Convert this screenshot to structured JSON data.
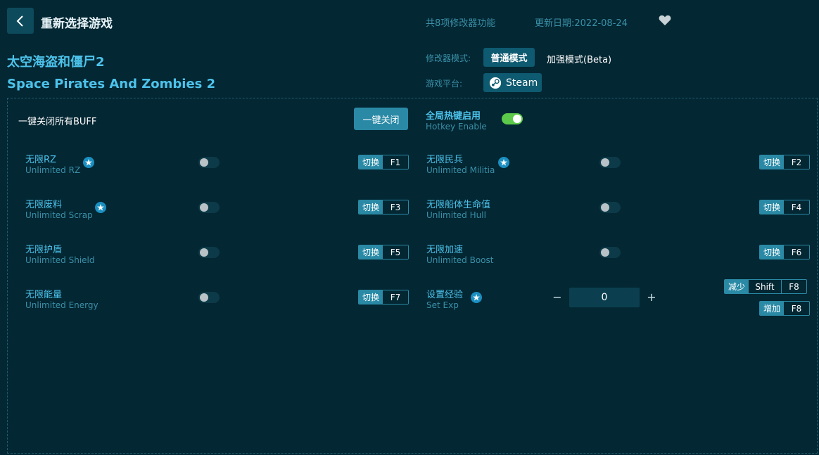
{
  "header": {
    "reselect_label": "重新选择游戏",
    "feature_count": "共8项修改器功能",
    "update_date": "更新日期:2022-08-24",
    "back_icon": "chevron-left-icon",
    "favorite_icon": "heart-icon"
  },
  "game": {
    "title_cn": "太空海盗和僵尸2",
    "title_en": "Space Pirates And Zombies 2"
  },
  "mode": {
    "label": "修改器模式:",
    "normal": "普通模式",
    "enhanced": "加强模式(Beta)",
    "selected": "普通模式"
  },
  "platform": {
    "label": "游戏平台:",
    "name": "Steam"
  },
  "controls": {
    "all_off_label": "一键关闭所有BUFF",
    "all_off_button": "一键关闭",
    "hotkey_cn": "全局热键启用",
    "hotkey_en": "Hotkey Enable",
    "hotkey_enabled": true
  },
  "cheats": [
    {
      "cn": "无限RZ",
      "en": "Unlimited RZ",
      "star": true,
      "on": false,
      "action": "切换",
      "key": "F1"
    },
    {
      "cn": "无限民兵",
      "en": "Unlimited Militia",
      "star": true,
      "on": false,
      "action": "切换",
      "key": "F2"
    },
    {
      "cn": "无限废料",
      "en": "Unlimited Scrap",
      "star": true,
      "on": false,
      "action": "切换",
      "key": "F3"
    },
    {
      "cn": "无限船体生命值",
      "en": "Unlimited Hull",
      "star": false,
      "on": false,
      "action": "切换",
      "key": "F4"
    },
    {
      "cn": "无限护盾",
      "en": "Unlimited Shield",
      "star": false,
      "on": false,
      "action": "切换",
      "key": "F5"
    },
    {
      "cn": "无限加速",
      "en": "Unlimited Boost",
      "star": false,
      "on": false,
      "action": "切换",
      "key": "F6"
    },
    {
      "cn": "无限能量",
      "en": "Unlimited Energy",
      "star": false,
      "on": false,
      "action": "切换",
      "key": "F7"
    }
  ],
  "set_exp": {
    "cn": "设置经验",
    "en": "Set Exp",
    "value": "0",
    "minus": "−",
    "plus": "+",
    "decrease_label": "减少",
    "decrease_mod": "Shift",
    "decrease_key": "F8",
    "increase_label": "增加",
    "increase_key": "F8"
  },
  "colors": {
    "background": "#032733",
    "accent": "#4dc3eb",
    "button": "#2a8aa6",
    "toggle_on": "#5cc94a"
  }
}
